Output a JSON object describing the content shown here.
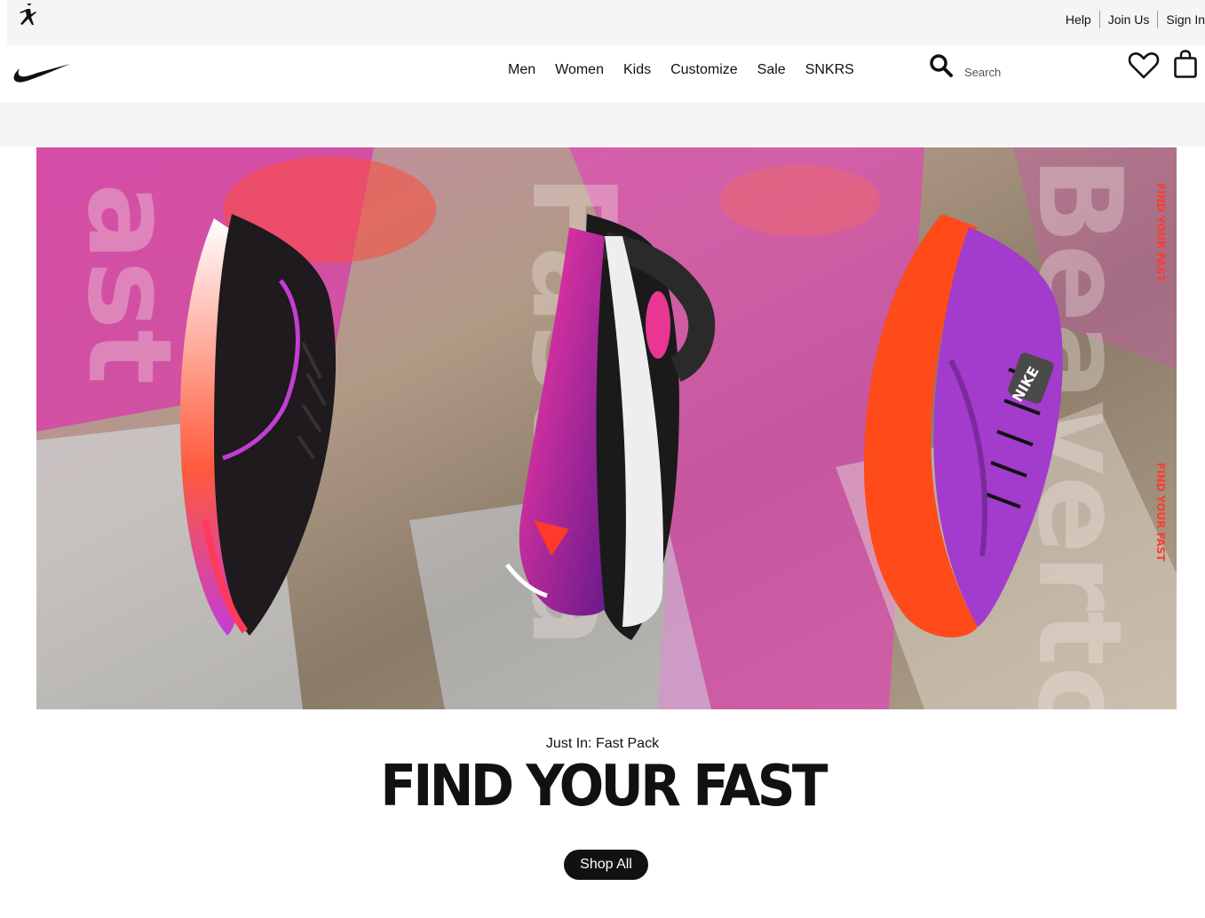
{
  "utility_bar": {
    "links": [
      "Help",
      "Join Us",
      "Sign In"
    ]
  },
  "nav": {
    "items": [
      "Men",
      "Women",
      "Kids",
      "Customize",
      "Sale",
      "SNKRS"
    ],
    "search_placeholder": "Search"
  },
  "hero": {
    "image_text": {
      "side_tag": "FIND YOUR FAST",
      "shoe_brand": "NIKE"
    },
    "subtitle": "Just In: Fast Pack",
    "title": "FIND YOUR FAST",
    "cta_label": "Shop All"
  },
  "colors": {
    "black": "#111111",
    "bar_grey": "#f5f5f5",
    "hot_pink": "#e040b8",
    "crimson": "#ff3b1f",
    "purple": "#9b30c8"
  },
  "icons": [
    "jordan-jumpman-icon",
    "nike-swoosh-icon",
    "search-icon",
    "heart-icon",
    "bag-icon"
  ]
}
